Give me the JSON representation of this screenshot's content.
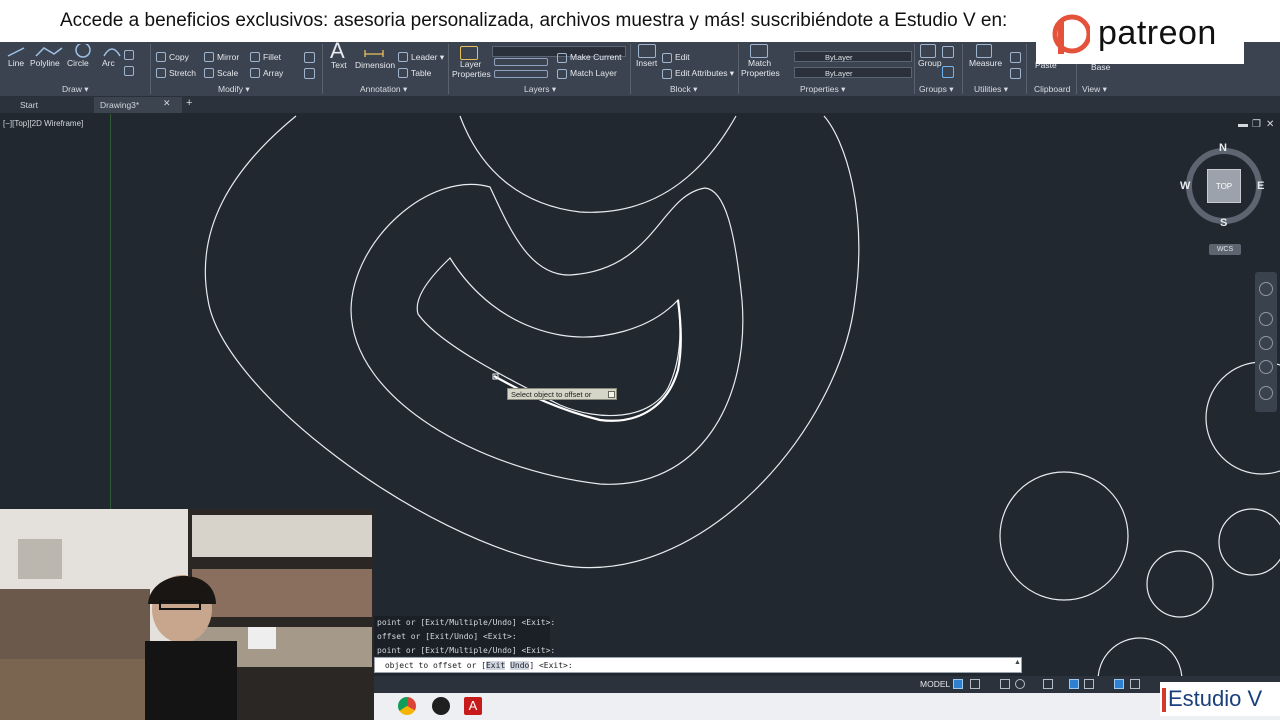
{
  "banner": {
    "promo_text": "Accede a beneficios exclusivos: asesoria personalizada, archivos muestra y más! suscribiéndote a Estudio V en:",
    "patreon_word": "patreon"
  },
  "ribbon": {
    "draw": {
      "line": "Line",
      "polyline": "Polyline",
      "circle": "Circle",
      "arc": "Arc",
      "title": "Draw ▾"
    },
    "modify": {
      "copy": "Copy",
      "mirror": "Mirror",
      "fillet": "Fillet",
      "stretch": "Stretch",
      "scale": "Scale",
      "array": "Array",
      "title": "Modify ▾"
    },
    "annotation": {
      "text": "Text",
      "dimension": "Dimension",
      "leader": "Leader ▾",
      "table": "Table",
      "title": "Annotation ▾"
    },
    "layers": {
      "layer_properties_1": "Layer",
      "layer_properties_2": "Properties",
      "make_current": "Make Current",
      "match_layer": "Match Layer",
      "title": "Layers ▾"
    },
    "block": {
      "insert": "Insert",
      "edit": "Edit",
      "edit_attributes": "Edit Attributes ▾",
      "title": "Block ▾"
    },
    "properties": {
      "match_1": "Match",
      "match_2": "Properties",
      "bylayer_1": "ByLayer",
      "bylayer_2": "ByLayer",
      "title": "Properties ▾"
    },
    "groups": {
      "group": "Group",
      "title": "Groups ▾"
    },
    "utilities": {
      "measure": "Measure",
      "title": "Utilities ▾"
    },
    "clipboard": {
      "paste": "Paste",
      "title": "Clipboard"
    },
    "view": {
      "base": "Base",
      "title": "View ▾"
    }
  },
  "tabs": {
    "start": "Start",
    "drawing": "Drawing3*",
    "close": "✕",
    "plus": "+"
  },
  "viewport": {
    "label": "[−][Top][2D Wireframe]",
    "tooltip": "Select object to offset or",
    "viewcube": {
      "top": "TOP",
      "n": "N",
      "s": "S",
      "e": "E",
      "w": "W",
      "wcs": "WCS"
    }
  },
  "command": {
    "history": [
      "point or [Exit/Multiple/Undo] <Exit>:",
      "offset or [Exit/Undo] <Exit>:",
      "point or [Exit/Multiple/Undo] <Exit>:"
    ],
    "input_prefix": " object to offset or [",
    "opt_exit": "Exit",
    "opt_undo": "Undo",
    "input_suffix": "] <Exit>:"
  },
  "status": {
    "model": "MODEL"
  },
  "watermark": {
    "estudio": "Estudio V"
  },
  "colors": {
    "viewport_bg": "#212830",
    "ribbon_bg": "#3b4350",
    "curve": "#e8ecf0",
    "ucs_green": "#2f5a35",
    "patreon_red": "#e5523b"
  }
}
